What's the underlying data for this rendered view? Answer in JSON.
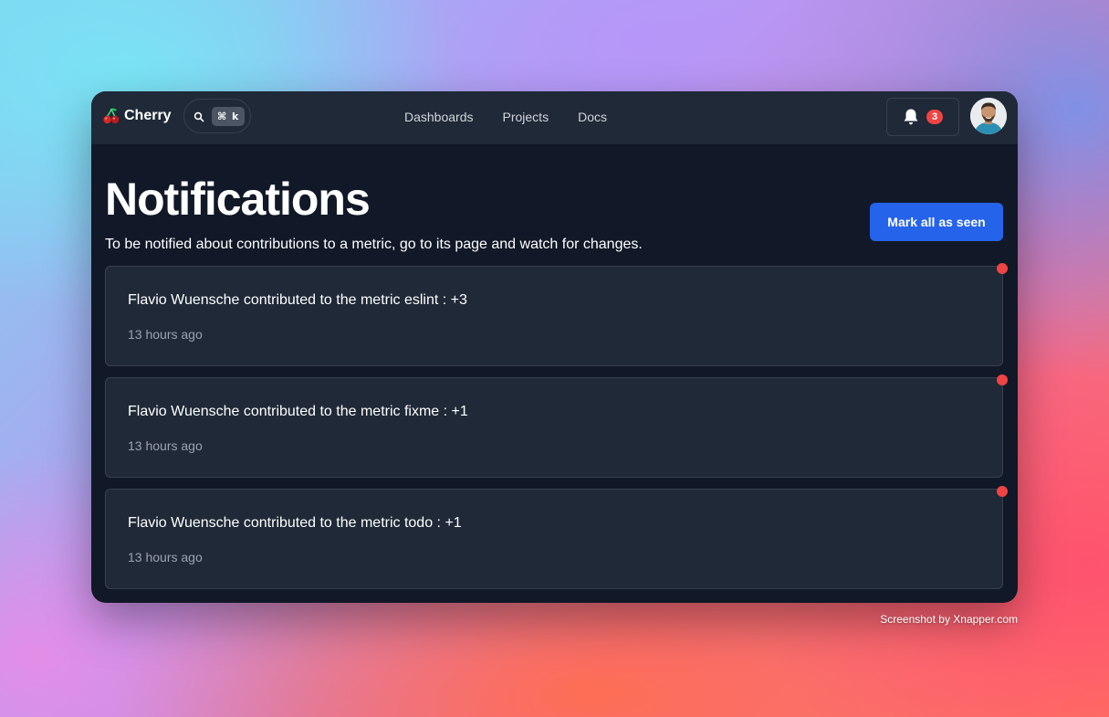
{
  "app": {
    "brand_name": "Cherry",
    "brand_icon": "cherry-icon",
    "search_shortcut": "⌘ k"
  },
  "nav": {
    "links": [
      {
        "label": "Dashboards"
      },
      {
        "label": "Projects"
      },
      {
        "label": "Docs"
      }
    ],
    "notification_count": "3"
  },
  "page": {
    "title": "Notifications",
    "subtitle": "To be notified about contributions to a metric, go to its page and watch for changes.",
    "mark_all_label": "Mark all as seen"
  },
  "notifications": [
    {
      "message": "Flavio Wuensche contributed to the metric eslint : +3",
      "time": "13 hours ago",
      "unread": true
    },
    {
      "message": "Flavio Wuensche contributed to the metric fixme : +1",
      "time": "13 hours ago",
      "unread": true
    },
    {
      "message": "Flavio Wuensche contributed to the metric todo : +1",
      "time": "13 hours ago",
      "unread": true
    }
  ],
  "watermark": "Screenshot by Xnapper.com",
  "colors": {
    "accent": "#2563eb",
    "badge": "#ef4444",
    "background": "#111827",
    "navbar": "#1f2937"
  }
}
